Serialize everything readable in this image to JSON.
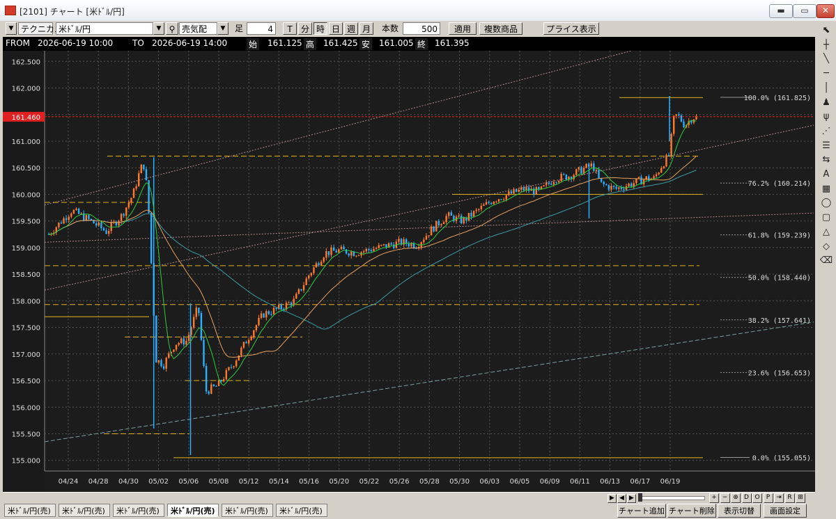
{
  "window": {
    "title": "[2101] チャート [米ﾄﾞﾙ/円]",
    "min": "▬",
    "max": "▭",
    "close": "✕"
  },
  "toolbar": {
    "mode": "テクニカル",
    "symbol": "米ﾄﾞﾙ/円",
    "side": "売気配",
    "ashi_label": "足",
    "ashi_value": "4",
    "periods": [
      "T",
      "分",
      "時",
      "日",
      "週",
      "月"
    ],
    "active_period": "時",
    "count_label": "本数",
    "count_value": "500",
    "apply": "適用",
    "multi": "複数商品",
    "price_display": "プライス表示"
  },
  "ohlc": {
    "from_label": "FROM",
    "from_value": "2026-06-19  10:00",
    "to_label": "TO",
    "to_value": "2026-06-19  14:00",
    "open_label": "始",
    "open": "161.125",
    "high_label": "高",
    "high": "161.425",
    "low_label": "安",
    "low": "161.005",
    "close_label": "終",
    "close": "161.395"
  },
  "chart_data": {
    "type": "candlestick",
    "ylim": [
      154.8,
      162.7
    ],
    "y_ticks": [
      "162.500",
      "162.000",
      "161.500",
      "161.000",
      "160.500",
      "160.000",
      "159.500",
      "159.000",
      "158.500",
      "158.000",
      "157.500",
      "157.000",
      "156.500",
      "156.000",
      "155.500",
      "155.000"
    ],
    "x_ticks": [
      "04/24",
      "04/28",
      "04/30",
      "05/02",
      "05/06",
      "05/08",
      "05/12",
      "05/14",
      "05/16",
      "05/20",
      "05/22",
      "05/26",
      "05/28",
      "05/30",
      "06/03",
      "06/05",
      "06/09",
      "06/11",
      "06/13",
      "06/17",
      "06/19"
    ],
    "current_price": "161.460",
    "fib_levels": [
      {
        "label": "100.0% (161.825)",
        "value": 161.825
      },
      {
        "label": "76.2% (160.214)",
        "value": 160.214
      },
      {
        "label": "61.8% (159.239)",
        "value": 159.239
      },
      {
        "label": "50.0% (158.440)",
        "value": 158.44
      },
      {
        "label": "38.2% (157.641)",
        "value": 157.641
      },
      {
        "label": "23.6% (156.653)",
        "value": 156.653
      },
      {
        "label": "0.0% (155.055)",
        "value": 155.055
      }
    ],
    "price_path": [
      [
        0,
        159.25
      ],
      [
        0.03,
        159.7
      ],
      [
        0.055,
        159.5
      ],
      [
        0.075,
        159.3
      ],
      [
        0.095,
        159.6
      ],
      [
        0.11,
        160.0
      ],
      [
        0.12,
        160.5
      ],
      [
        0.125,
        160.55
      ],
      [
        0.13,
        159.8
      ],
      [
        0.14,
        156.9
      ],
      [
        0.15,
        156.8
      ],
      [
        0.165,
        157.2
      ],
      [
        0.18,
        157.25
      ],
      [
        0.195,
        157.9
      ],
      [
        0.205,
        156.3
      ],
      [
        0.22,
        156.4
      ],
      [
        0.24,
        156.8
      ],
      [
        0.26,
        157.3
      ],
      [
        0.28,
        157.75
      ],
      [
        0.3,
        157.85
      ],
      [
        0.32,
        158.0
      ],
      [
        0.34,
        158.5
      ],
      [
        0.36,
        158.9
      ],
      [
        0.38,
        158.95
      ],
      [
        0.4,
        158.9
      ],
      [
        0.43,
        159.0
      ],
      [
        0.46,
        159.1
      ],
      [
        0.48,
        159.05
      ],
      [
        0.5,
        159.35
      ],
      [
        0.52,
        159.6
      ],
      [
        0.54,
        159.5
      ],
      [
        0.56,
        159.7
      ],
      [
        0.58,
        159.9
      ],
      [
        0.6,
        160.0
      ],
      [
        0.62,
        160.1
      ],
      [
        0.64,
        160.05
      ],
      [
        0.66,
        160.3
      ],
      [
        0.68,
        160.35
      ],
      [
        0.7,
        160.5
      ],
      [
        0.71,
        160.55
      ],
      [
        0.72,
        160.2
      ],
      [
        0.74,
        160.1
      ],
      [
        0.76,
        160.2
      ],
      [
        0.78,
        160.3
      ],
      [
        0.79,
        160.3
      ],
      [
        0.8,
        160.55
      ],
      [
        0.81,
        160.75
      ],
      [
        0.815,
        161.4
      ],
      [
        0.82,
        161.5
      ],
      [
        0.83,
        161.3
      ],
      [
        0.84,
        161.45
      ]
    ],
    "xlabel": "",
    "ylabel": ""
  },
  "sidebar": {
    "tools": [
      "pointer-icon",
      "crosshair-icon",
      "trendline-icon",
      "hline-icon",
      "vline-icon",
      "fib-icon",
      "fan-icon",
      "arc-icon",
      "channel-icon",
      "period-icon",
      "text-icon",
      "grid-icon",
      "ellipse-icon",
      "rect-icon",
      "triangle-icon",
      "eraser-icon",
      "eraser-all-icon"
    ],
    "tool_glyphs": [
      "⬉",
      "┼",
      "╲",
      "─",
      "│",
      "♟",
      "ψ",
      "⋰",
      "☰",
      "⇆",
      "A",
      "▦",
      "◯",
      "▢",
      "△",
      "◇",
      "⌫"
    ]
  },
  "scroll": {
    "nav": [
      "▶",
      "◀",
      "▶"
    ],
    "zoom": [
      "+",
      "−",
      "⊕",
      "D",
      "O",
      "P",
      "⇥",
      "R",
      "⊞"
    ]
  },
  "tabs": [
    "米ﾄﾞﾙ/円(売)",
    "米ﾄﾞﾙ/円(売)",
    "米ﾄﾞﾙ/円(売)",
    "米ﾄﾞﾙ/円(売)",
    "米ﾄﾞﾙ/円(売)",
    "米ﾄﾞﾙ/円(売)"
  ],
  "active_tab": 3,
  "footer_buttons": {
    "add": "チャート追加",
    "del": "チャート削除",
    "switch": "表示切替",
    "settings": "画面設定"
  },
  "colors": {
    "bg": "#1c1c1c",
    "up": "#ff7a2a",
    "down": "#2ab0ff",
    "ma_short": "#2ecc40",
    "ma_mid": "#e8a060",
    "ma_long": "#3a9aa8",
    "level": "#e3b21c",
    "current": "#e02020"
  }
}
